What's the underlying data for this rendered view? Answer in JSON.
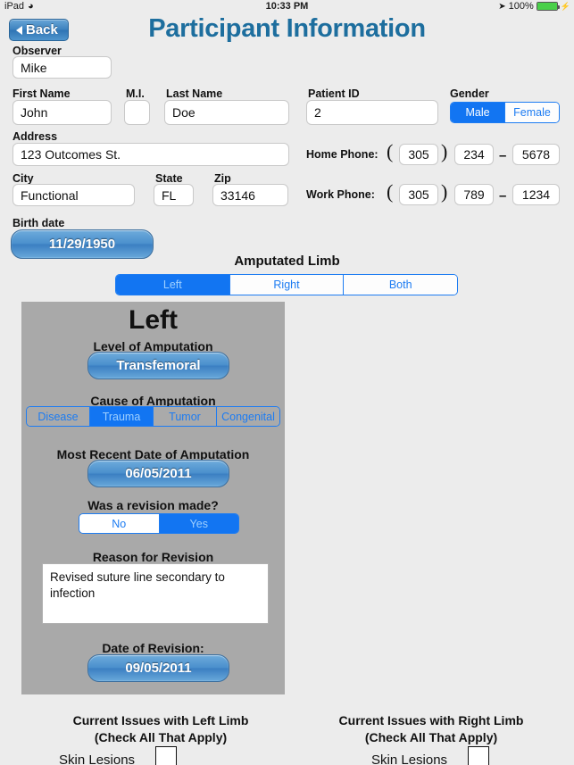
{
  "status_bar": {
    "device": "iPad",
    "wifi_icon": "wifi-icon",
    "time": "10:33 PM",
    "location_icon": "location-arrow-icon",
    "battery_percent": "100%",
    "battery_icon": "battery-full-icon",
    "charging_icon": "lightning-bolt-icon"
  },
  "nav": {
    "back_label": "Back",
    "back_icon": "chevron-left-icon",
    "title": "Participant Information"
  },
  "form": {
    "observer_label": "Observer",
    "observer_value": "Mike",
    "first_name_label": "First Name",
    "first_name_value": "John",
    "mi_label": "M.I.",
    "mi_value": "",
    "last_name_label": "Last Name",
    "last_name_value": "Doe",
    "patient_id_label": "Patient ID",
    "patient_id_value": "2",
    "gender_label": "Gender",
    "gender_options": [
      "Male",
      "Female"
    ],
    "gender_selected": "Male",
    "address_label": "Address",
    "address_value": "123 Outcomes St.",
    "city_label": "City",
    "city_value": "Functional",
    "state_label": "State",
    "state_value": "FL",
    "zip_label": "Zip",
    "zip_value": "33146",
    "home_phone_label": "Home Phone:",
    "home_phone_area": "305",
    "home_phone_prefix": "234",
    "home_phone_line": "5678",
    "work_phone_label": "Work Phone:",
    "work_phone_area": "305",
    "work_phone_prefix": "789",
    "work_phone_line": "1234",
    "paren_open": "(",
    "paren_close": ")",
    "dash": "–",
    "birth_date_label": "Birth date",
    "birth_date_value": "11/29/1950"
  },
  "amputated_limb": {
    "heading": "Amputated Limb",
    "options": [
      "Left",
      "Right",
      "Both"
    ],
    "selected": "Left"
  },
  "limb_panel": {
    "side_title": "Left",
    "level_label": "Level of Amputation",
    "level_value": "Transfemoral",
    "cause_label": "Cause of Amputation",
    "cause_options": [
      "Disease",
      "Trauma",
      "Tumor",
      "Congenital"
    ],
    "cause_selected": "Trauma",
    "amputation_date_label": "Most Recent Date of Amputation",
    "amputation_date_value": "06/05/2011",
    "revision_question": "Was a revision made?",
    "revision_options": [
      "No",
      "Yes"
    ],
    "revision_selected": "Yes",
    "revision_reason_label": "Reason for Revision",
    "revision_reason_value": "Revised suture line secondary to infection",
    "revision_date_label": "Date of Revision:",
    "revision_date_value": "09/05/2011"
  },
  "current_issues": {
    "left_title_line1": "Current Issues with Left Limb",
    "left_title_line2": "(Check All That Apply)",
    "right_title_line1": "Current Issues with Right Limb",
    "right_title_line2": "(Check All That Apply)",
    "left_items": [
      "Skin Lesions"
    ],
    "right_items": [
      "Skin Lesions"
    ]
  },
  "colors": {
    "accent_blue": "#1275f2",
    "title_blue": "#1d6e9e",
    "panel_gray": "#a9a9a9",
    "page_bg": "#ececec",
    "battery_green": "#49d049"
  }
}
